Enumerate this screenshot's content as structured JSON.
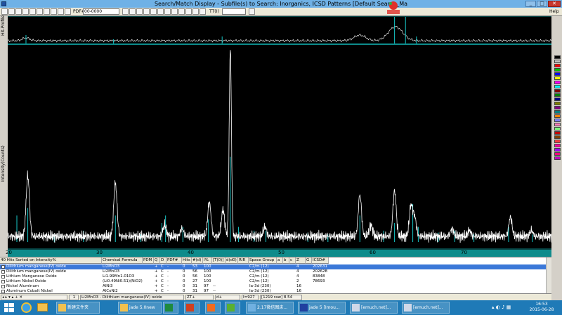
{
  "window": {
    "title": "Search/Match Display - Subfile(s) to Search: Inorganics, ICSD Patterns [Default Search_Ma",
    "help": "Help"
  },
  "toolbar": {
    "pdf_label": "PDF#",
    "pdf_value": "00-0000",
    "tt_label": "TT(I)",
    "tt_value": ""
  },
  "left_labels": {
    "top": "Hit-Profile",
    "main": "Intensity(Counts)"
  },
  "xaxis": {
    "ticks": [
      "20",
      "30",
      "40",
      "50",
      "60",
      "70"
    ]
  },
  "table": {
    "title": "40 Hits Sorted on Intensity%",
    "headers": [
      "40 Hits Sorted on Intensity%",
      "Chemical Formula",
      "PDM",
      "Q",
      "D",
      "PDF#",
      "Hits",
      "#(d)",
      "I%",
      "[T(0)]",
      "d(d0)",
      "RIR",
      "Space Group",
      "a",
      "b",
      "c",
      "Z",
      "G",
      "ICSD#"
    ],
    "rows": [
      {
        "name": "Dilithium manganese(IV) oxide",
        "formula": "Li2MnO3",
        "pdm": "",
        "q": "+",
        "d": "C",
        "pdf": "-",
        "hits": "0",
        "nd": "53",
        "ip": "100",
        "t0": "",
        "dd0": "",
        "rir": "",
        "sg": "C2/m (12)",
        "z": "4",
        "icsd": "202631",
        "selected": true
      },
      {
        "name": "Dilithium manganese(IV) oxide",
        "formula": "Li2MnO3",
        "pdm": "",
        "q": "+",
        "d": "C",
        "pdf": "-",
        "hits": "0",
        "nd": "56",
        "ip": "100",
        "t0": "",
        "dd0": "",
        "rir": "",
        "sg": "C2/m (12)",
        "z": "4",
        "icsd": "202628",
        "selected": false
      },
      {
        "name": "Lithium Manganese Oxide",
        "formula": "Li1.99Mn1.01O3",
        "pdm": "",
        "q": "+",
        "d": "C",
        "pdf": "-",
        "hits": "0",
        "nd": "56",
        "ip": "100",
        "t0": "",
        "dd0": "",
        "rir": "",
        "sg": "C2/m (12)",
        "z": "4",
        "icsd": "83848",
        "selected": false
      },
      {
        "name": "Lithium Nickel Oxide",
        "formula": "(Li0.49Ni0.51)(NiO2)",
        "pdm": "",
        "q": "+",
        "d": "C",
        "pdf": "-",
        "hits": "0",
        "nd": "27",
        "ip": "100",
        "t0": "",
        "dd0": "",
        "rir": "",
        "sg": "C2/m (12)",
        "z": "2",
        "icsd": "78693",
        "selected": false
      },
      {
        "name": "Nickel Aluminum",
        "formula": "AlNi3",
        "pdm": "",
        "q": "+",
        "d": "C",
        "pdf": "-",
        "hits": "0",
        "nd": "31",
        "ip": "97",
        "t0": "--",
        "dd0": "",
        "rir": "",
        "sg": "Ia-3d (230)",
        "z": "16",
        "icsd": "",
        "selected": false
      },
      {
        "name": "Aluminum Cobalt Nickel",
        "formula": "AlCoNi2",
        "pdm": "",
        "q": "+",
        "d": "C",
        "pdf": "-",
        "hits": "0",
        "nd": "31",
        "ip": "97",
        "t0": "--",
        "dd0": "",
        "rir": "",
        "sg": "Ia-3d (230)",
        "z": "16",
        "icsd": "",
        "selected": false
      }
    ]
  },
  "statusbar": {
    "page": "1",
    "selection": "Li2MnO3 - Dilithium manganese(IV) oxide",
    "tt": "ZT+",
    "d": "d+",
    "i": "I=927",
    "raw": "[1219 raw] 8.54"
  },
  "taskbar": {
    "items": [
      "新建文件夹",
      "jade 5.0new",
      "",
      "",
      "",
      "2.17微信图床...",
      "jade 5 [Imou...",
      "[emuch.net]...",
      "[emuch.net]..."
    ],
    "time": "16:53",
    "date": "2015-06-28"
  },
  "colors": {
    "plot_bg": "#000000",
    "trace": "#ffffff",
    "reference": "#18c8c8",
    "teal_bar": "#0e8b8b",
    "selection": "#3b78d8",
    "taskbar": "#1f7ab7"
  },
  "palette": [
    "#000000",
    "#c0c0c0",
    "#ff0000",
    "#00c000",
    "#0000ff",
    "#ffff00",
    "#ff00ff",
    "#00ffff",
    "#800000",
    "#008000",
    "#000080",
    "#808000",
    "#800080",
    "#008080",
    "#ff8000",
    "#8080ff",
    "#ff80c0",
    "#80ff80",
    "#c00000",
    "#804000",
    "#ff4040",
    "#ff00a0",
    "#a000ff",
    "#ff0080",
    "#c000c0"
  ]
}
